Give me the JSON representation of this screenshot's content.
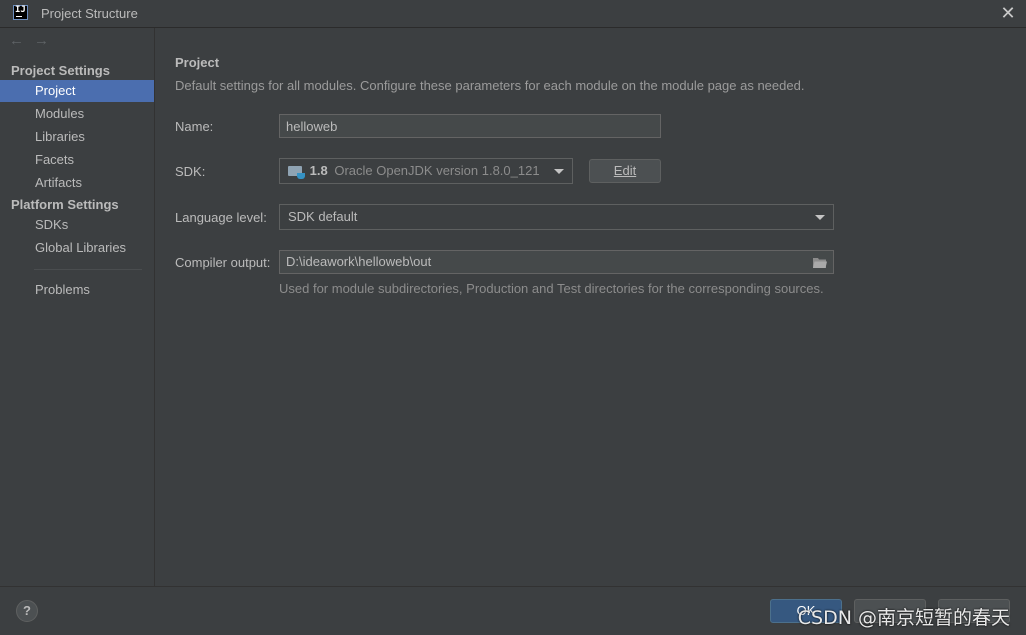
{
  "window": {
    "title": "Project Structure"
  },
  "app_icon": {
    "text": "IJ"
  },
  "sidebar": {
    "groups": [
      {
        "title": "Project Settings"
      },
      {
        "title": "Platform Settings"
      }
    ],
    "items": [
      {
        "label": "Project",
        "selected": true
      },
      {
        "label": "Modules"
      },
      {
        "label": "Libraries"
      },
      {
        "label": "Facets"
      },
      {
        "label": "Artifacts"
      },
      {
        "label": "SDKs"
      },
      {
        "label": "Global Libraries"
      },
      {
        "label": "Problems"
      }
    ]
  },
  "main": {
    "title": "Project",
    "description": "Default settings for all modules. Configure these parameters for each module on the module page as needed.",
    "name_label": "Name:",
    "name_value": "helloweb",
    "sdk_label": "SDK:",
    "sdk_version": "1.8",
    "sdk_desc": "Oracle OpenJDK version 1.8.0_121",
    "edit_label": "Edit",
    "language_label": "Language level:",
    "language_value": "SDK default",
    "compiler_label": "Compiler output:",
    "compiler_value": "D:\\ideawork\\helloweb\\out",
    "compiler_hint": "Used for module subdirectories, Production and Test directories for the corresponding sources."
  },
  "bottom": {
    "help_label": "?",
    "ok_label": "OK",
    "cancel_label": "",
    "apply_label": "",
    "watermark": "CSDN @南京短暂的春天"
  },
  "colors": {
    "background": "#3c3f41",
    "selection": "#4b6eaf",
    "primary_button": "#365880"
  }
}
